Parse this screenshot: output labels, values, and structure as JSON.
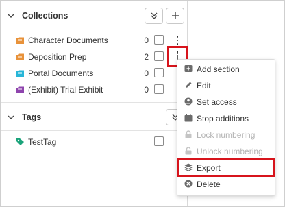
{
  "collections": {
    "title": "Collections",
    "items": [
      {
        "label": "Character Documents",
        "count": "0",
        "color": "#e8923a"
      },
      {
        "label": "Deposition Prep",
        "count": "2",
        "color": "#e8923a"
      },
      {
        "label": "Portal Documents",
        "count": "0",
        "color": "#27b6d8"
      },
      {
        "label": "(Exhibit) Trial Exhibit",
        "count": "0",
        "color": "#8e44ad"
      }
    ]
  },
  "tags": {
    "title": "Tags",
    "items": [
      {
        "label": "TestTag",
        "color": "#1aa37a"
      }
    ]
  },
  "context_menu": {
    "items": [
      {
        "label": "Add section",
        "icon": "add-section-icon",
        "disabled": false
      },
      {
        "label": "Edit",
        "icon": "pencil-icon",
        "disabled": false
      },
      {
        "label": "Set access",
        "icon": "user-circle-icon",
        "disabled": false
      },
      {
        "label": "Stop additions",
        "icon": "calendar-icon",
        "disabled": false
      },
      {
        "label": "Lock numbering",
        "icon": "lock-icon",
        "disabled": true
      },
      {
        "label": "Unlock numbering",
        "icon": "unlock-icon",
        "disabled": true
      },
      {
        "label": "Export",
        "icon": "layers-icon",
        "disabled": false
      },
      {
        "label": "Delete",
        "icon": "delete-circle-icon",
        "disabled": false
      }
    ]
  },
  "colors": {
    "highlight": "#d7141c",
    "icon_gray": "#6b6b6b",
    "disabled_gray": "#c4c4c4"
  }
}
